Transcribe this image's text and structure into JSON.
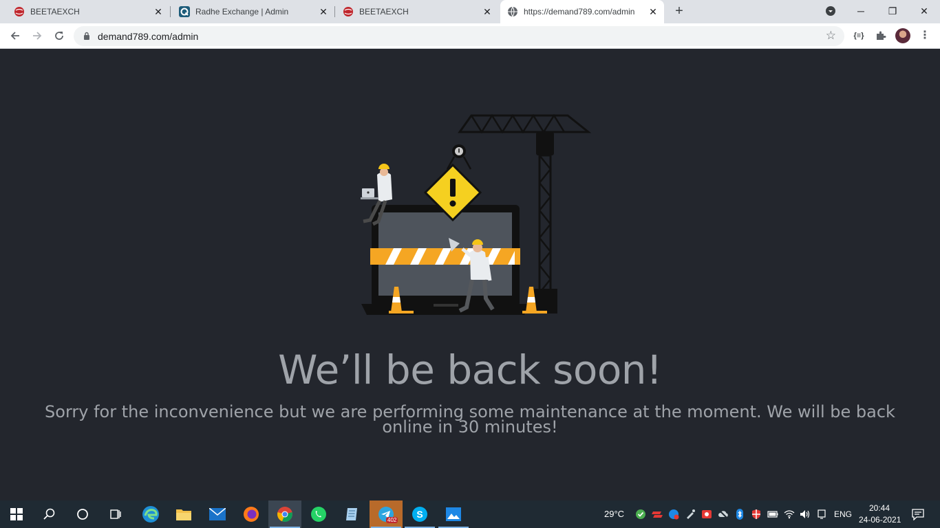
{
  "browser": {
    "tabs": [
      {
        "title": "BEETAEXCH",
        "favicon": "red-ball-favicon",
        "active": false
      },
      {
        "title": "Radhe Exchange | Admin",
        "favicon": "radhe-q-favicon",
        "active": false
      },
      {
        "title": "BEETAEXCH",
        "favicon": "red-ball-favicon",
        "active": false
      },
      {
        "title": "https://demand789.com/admin",
        "favicon": "globe-favicon",
        "active": true
      }
    ],
    "url": "demand789.com/admin"
  },
  "page": {
    "heading": "We’ll be back soon!",
    "message": "Sorry for the inconvenience but we are performing some maintenance at the moment. We will be back online in 30 minutes!",
    "illustration": "maintenance-construction-illustration"
  },
  "taskbar": {
    "apps": [
      "start-icon",
      "search-icon",
      "cortana-icon",
      "task-view-icon",
      "edge-icon",
      "file-explorer-icon",
      "mail-icon",
      "firefox-icon",
      "chrome-icon",
      "whatsapp-icon",
      "notepad-icon",
      "telegram-icon",
      "skype-icon",
      "photos-icon"
    ],
    "telegram_badge": "402",
    "weather": "29°C",
    "language": "ENG",
    "time": "20:44",
    "date": "24-06-2021"
  },
  "colors": {
    "page_bg": "#23262d",
    "text": "#9fa3a9",
    "warning_yellow": "#f5d020",
    "stripe_orange": "#f5a623"
  }
}
